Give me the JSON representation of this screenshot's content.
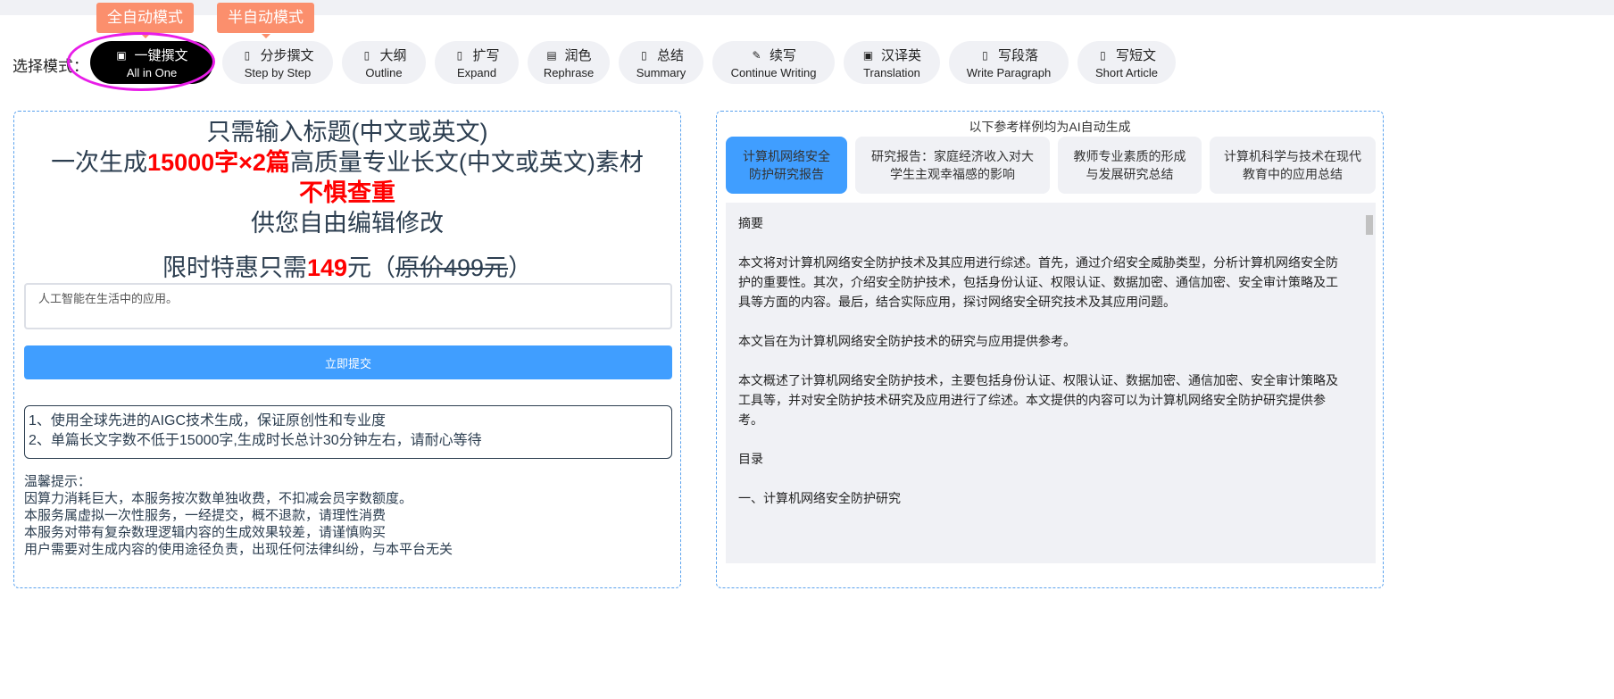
{
  "mode_select": {
    "label": "选择模式：",
    "tags": {
      "auto": "全自动模式",
      "semi": "半自动模式"
    },
    "modes": [
      {
        "cn": "一键撰文",
        "en": "All in One",
        "icon": "chat-icon",
        "active": true
      },
      {
        "cn": "分步撰文",
        "en": "Step by Step",
        "icon": "document-icon"
      },
      {
        "cn": "大纲",
        "en": "Outline",
        "icon": "document-plus-icon"
      },
      {
        "cn": "扩写",
        "en": "Expand",
        "icon": "edit-document-icon"
      },
      {
        "cn": "润色",
        "en": "Rephrase",
        "icon": "list-icon"
      },
      {
        "cn": "总结",
        "en": "Summary",
        "icon": "document-icon"
      },
      {
        "cn": "续写",
        "en": "Continue Writing",
        "icon": "pen-icon"
      },
      {
        "cn": "汉译英",
        "en": "Translation",
        "icon": "translate-icon"
      },
      {
        "cn": "写段落",
        "en": "Write Paragraph",
        "icon": "paragraph-icon"
      },
      {
        "cn": "写短文",
        "en": "Short Article",
        "icon": "paragraph-icon"
      }
    ]
  },
  "left": {
    "line1": "只需输入标题(中文或英文)",
    "line2_a": "一次生成",
    "line2_b": "15000字×2篇",
    "line2_c": "高质量专业长文(中文或英文)素材",
    "line3": "不惧查重",
    "line4": "供您自由编辑修改",
    "price_a": "限时特惠只需",
    "price_b": "149",
    "price_c": "元（",
    "price_d": "原价499元",
    "price_e": "）",
    "input_value": "人工智能在生活中的应用。",
    "submit_label": "立即提交",
    "notice": [
      "1、使用全球先进的AIGC技术生成，保证原创性和专业度",
      "2、单篇长文字数不低于15000字,生成时长总计30分钟左右，请耐心等待"
    ],
    "tips": [
      "温馨提示：",
      "因算力消耗巨大，本服务按次数单独收费，不扣减会员字数额度。",
      "本服务属虚拟一次性服务，一经提交，概不退款，请理性消费",
      "本服务对带有复杂数理逻辑内容的生成效果较差，请谨慎购买",
      "用户需要对生成内容的使用途径负责，出现任何法律纠纷，与本平台无关"
    ]
  },
  "right": {
    "heading": "以下参考样例均为AI自动生成",
    "samples": [
      "计算机网络安全防护研究报告",
      "研究报告：家庭经济收入对大学生主观幸福感的影响",
      "教师专业素质的形成与发展研究总结",
      "计算机科学与技术在现代教育中的应用总结"
    ],
    "content": [
      "摘要",
      "",
      "本文将对计算机网络安全防护技术及其应用进行综述。首先，通过介绍安全威胁类型，分析计算机网络安全防护的重要性。其次，介绍安全防护技术，包括身份认证、权限认证、数据加密、通信加密、安全审计策略及工具等方面的内容。最后，结合实际应用，探讨网络安全研究技术及其应用问题。",
      "本文旨在为计算机网络安全防护技术的研究与应用提供参考。",
      "本文概述了计算机网络安全防护技术，主要包括身份认证、权限认证、数据加密、通信加密、安全审计策略及工具等，并对安全防护技术研究及应用进行了综述。本文提供的内容可以为计算机网络安全防护研究提供参考。",
      "目录",
      "",
      "一、计算机网络安全防护研究"
    ]
  },
  "colors": {
    "accent": "#409eff",
    "tag": "#fb8f6d",
    "highlight": "#ff0000",
    "ring": "#e81de8"
  }
}
